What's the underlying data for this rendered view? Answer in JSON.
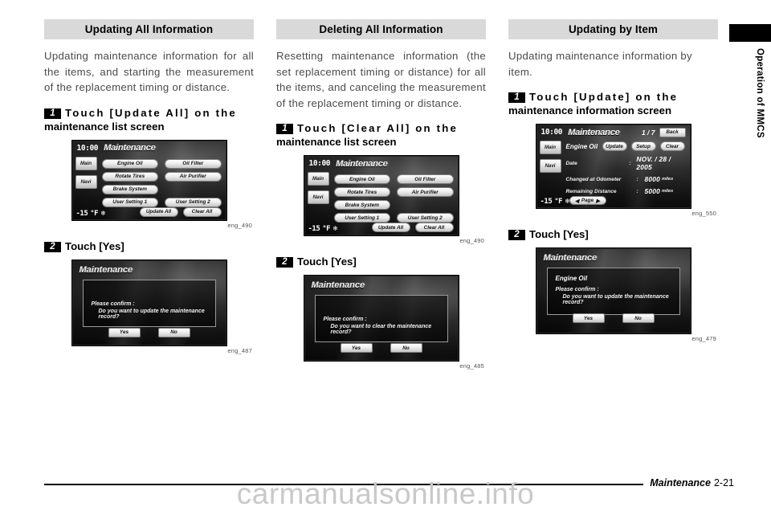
{
  "sidebar": {
    "vertical_label": "Operation of MMCS"
  },
  "footer": {
    "section": "Maintenance",
    "page": "2-21",
    "watermark": "carmanualsonline.info"
  },
  "columns": [
    {
      "heading": "Updating All Information",
      "paragraph": "Updating maintenance information for all the items, and starting the measurement of the replacement timing or distance.",
      "steps": [
        {
          "num": "1",
          "line1": "Touch [Update All] on the",
          "line2": "maintenance list screen",
          "figure": {
            "type": "list",
            "caption": "eng_490",
            "clock": "10:00",
            "title": "Maintenance",
            "rail": [
              "Main",
              "Navi"
            ],
            "temp": "-15",
            "temp_unit": "°F",
            "snow_icon": "snowflake-icon",
            "items": [
              "Engine Oil",
              "Oil Filter",
              "Rotate Tires",
              "Air Purifier",
              "Brake System",
              "",
              "User Setting 1",
              "User Setting 2"
            ],
            "actions": [
              "Update All",
              "Clear All"
            ]
          }
        },
        {
          "num": "2",
          "line1": "Touch [Yes]",
          "line2": "",
          "figure": {
            "type": "dialog",
            "caption": "eng_487",
            "title": "Maintenance",
            "item": "",
            "confirm_line1": "Please confirm :",
            "confirm_line2": "Do you want to update the maintenance record?",
            "buttons": [
              "Yes",
              "No"
            ]
          }
        }
      ]
    },
    {
      "heading": "Deleting All Information",
      "paragraph": "Resetting maintenance information (the set replacement timing or distance) for all the items, and canceling the measurement of the replacement timing or distance.",
      "steps": [
        {
          "num": "1",
          "line1": "Touch [Clear All] on the",
          "line2": "maintenance list screen",
          "figure": {
            "type": "list",
            "caption": "eng_490",
            "clock": "10:00",
            "title": "Maintenance",
            "rail": [
              "Main",
              "Navi"
            ],
            "temp": "-15",
            "temp_unit": "°F",
            "snow_icon": "snowflake-icon",
            "items": [
              "Engine Oil",
              "Oil Filter",
              "Rotate Tires",
              "Air Purifier",
              "Brake System",
              "",
              "User Setting 1",
              "User Setting 2"
            ],
            "actions": [
              "Update All",
              "Clear All"
            ]
          }
        },
        {
          "num": "2",
          "line1": "Touch [Yes]",
          "line2": "",
          "figure": {
            "type": "dialog",
            "caption": "eng_485",
            "title": "Maintenance",
            "item": "",
            "confirm_line1": "Please confirm :",
            "confirm_line2": "Do you want to clear the maintenance record?",
            "buttons": [
              "Yes",
              "No"
            ]
          }
        }
      ]
    },
    {
      "heading": "Updating by Item",
      "paragraph": "Updating maintenance information by item.",
      "steps": [
        {
          "num": "1",
          "line1": "Touch [Update] on the",
          "line2": "maintenance information screen",
          "figure": {
            "type": "info",
            "caption": "eng_550",
            "clock": "10:00",
            "title": "Maintenance",
            "page_indicator": "1 / 7",
            "back_label": "Back",
            "rail": [
              "Main",
              "Navi"
            ],
            "temp": "-15",
            "temp_unit": "°F",
            "snow_icon": "snowflake-icon",
            "item_name": "Engine Oil",
            "item_buttons": [
              "Update",
              "Setup",
              "Clear"
            ],
            "rows": [
              {
                "label": "Date",
                "value": "NOV. / 28 / 2005",
                "unit": ""
              },
              {
                "label": "Changed at Odometer",
                "value": "8000",
                "unit": "miles"
              },
              {
                "label": "Remaining Distance",
                "value": "5000",
                "unit": "miles"
              }
            ],
            "page_button": "Page"
          }
        },
        {
          "num": "2",
          "line1": "Touch [Yes]",
          "line2": "",
          "figure": {
            "type": "dialog",
            "caption": "eng_479",
            "title": "Maintenance",
            "item": "Engine Oil",
            "confirm_line1": "Please confirm :",
            "confirm_line2": "Do you want to update the maintenance record?",
            "buttons": [
              "Yes",
              "No"
            ]
          }
        }
      ]
    }
  ]
}
